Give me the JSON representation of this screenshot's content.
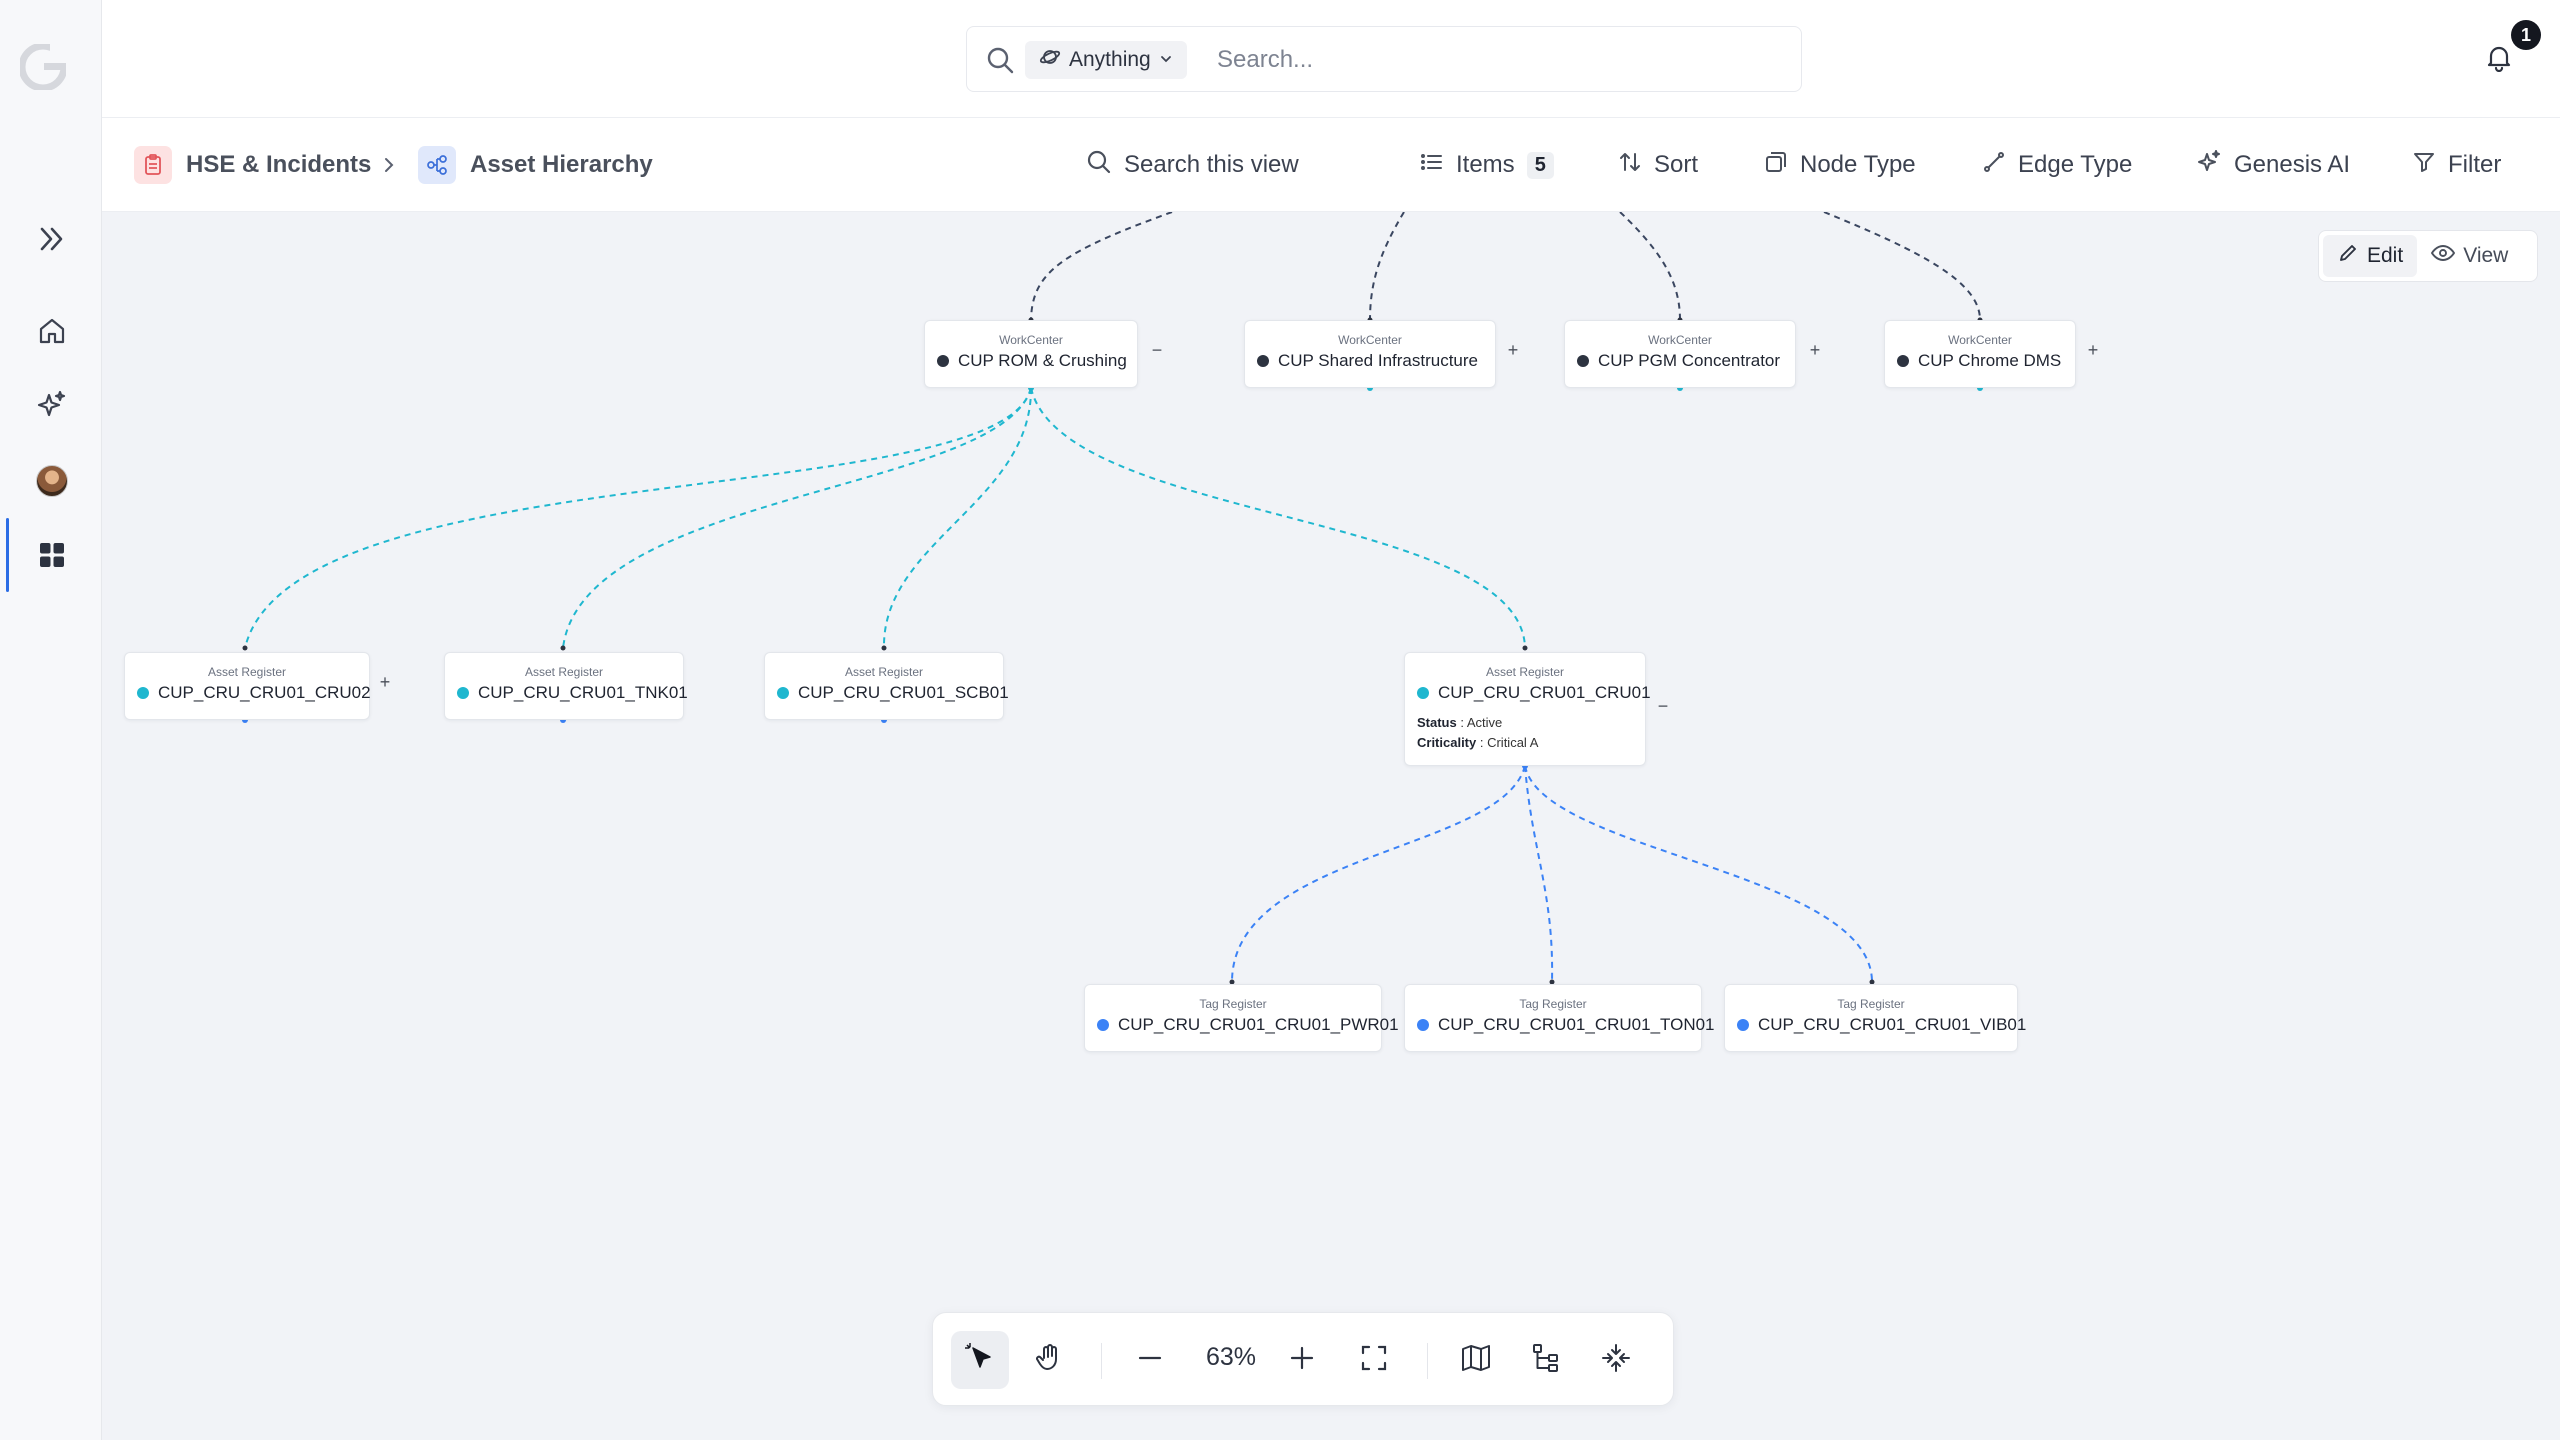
{
  "topbar": {
    "scope_label": "Anything",
    "search_placeholder": "Search...",
    "notification_count": "1"
  },
  "breadcrumb": {
    "items": [
      {
        "label": "HSE & Incidents",
        "icon": "clipboard-icon"
      },
      {
        "label": "Asset Hierarchy",
        "icon": "hierarchy-icon"
      }
    ]
  },
  "toolbar": {
    "search_view": "Search this view",
    "items_label": "Items",
    "items_count": "5",
    "sort_label": "Sort",
    "node_type_label": "Node Type",
    "edge_type_label": "Edge Type",
    "genesis_label": "Genesis AI",
    "filter_label": "Filter"
  },
  "mode": {
    "edit_label": "Edit",
    "view_label": "View"
  },
  "colors": {
    "workcenter": "#2d3340",
    "asset": "#1fb7cf",
    "tag": "#3b82f6",
    "edge_top": "#3a4660",
    "edge_asset": "#1fb7cf",
    "edge_tag": "#3b82f6"
  },
  "nodes": {
    "wc1": {
      "type": "WorkCenter",
      "name": "CUP ROM & Crushing"
    },
    "wc2": {
      "type": "WorkCenter",
      "name": "CUP Shared Infrastructure"
    },
    "wc3": {
      "type": "WorkCenter",
      "name": "CUP PGM Concentrator"
    },
    "wc4": {
      "type": "WorkCenter",
      "name": "CUP Chrome DMS"
    },
    "ar1": {
      "type": "Asset Register",
      "name": "CUP_CRU_CRU01_CRU02"
    },
    "ar2": {
      "type": "Asset Register",
      "name": "CUP_CRU_CRU01_TNK01"
    },
    "ar3": {
      "type": "Asset Register",
      "name": "CUP_CRU_CRU01_SCB01"
    },
    "ar4": {
      "type": "Asset Register",
      "name": "CUP_CRU_CRU01_CRU01",
      "status_key": "Status",
      "status_val": "Active",
      "crit_key": "Criticality",
      "crit_val": "Critical A"
    },
    "tr1": {
      "type": "Tag Register",
      "name": "CUP_CRU_CRU01_CRU01_PWR01"
    },
    "tr2": {
      "type": "Tag Register",
      "name": "CUP_CRU_CRU01_CRU01_TON01"
    },
    "tr3": {
      "type": "Tag Register",
      "name": "CUP_CRU_CRU01_CRU01_VIB01"
    }
  },
  "expanders": {
    "minus": "−",
    "plus": "+"
  },
  "bottom": {
    "zoom": "63%"
  }
}
